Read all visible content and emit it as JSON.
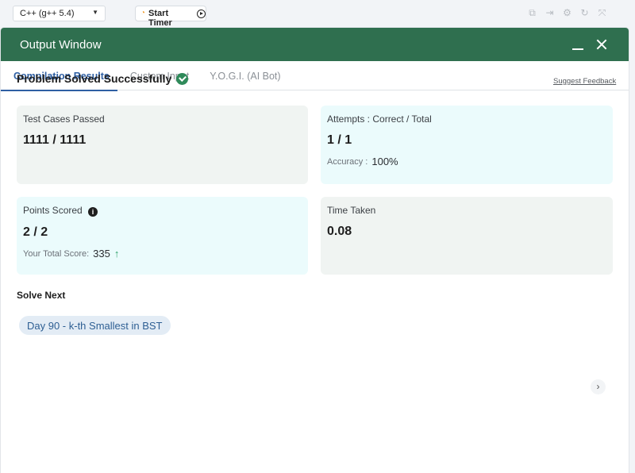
{
  "toolbar": {
    "language": "C++ (g++ 5.4)",
    "timer_label": "Start Timer"
  },
  "window": {
    "title": "Output Window"
  },
  "tabs": [
    {
      "label": "Compilation Results",
      "active": true
    },
    {
      "label": "Custom Input",
      "active": false
    },
    {
      "label": "Y.O.G.I. (AI Bot)",
      "active": false
    }
  ],
  "status": {
    "title": "Problem Solved Successfully",
    "feedback_link": "Suggest Feedback"
  },
  "cards": {
    "test_cases": {
      "label": "Test Cases Passed",
      "value": "1111 / 1111"
    },
    "attempts": {
      "label": "Attempts : Correct / Total",
      "value": "1 / 1",
      "sub_label": "Accuracy :",
      "sub_value": "100%"
    },
    "points": {
      "label": "Points Scored",
      "value": "2 / 2",
      "sub_label": "Your Total Score:",
      "sub_value": "335"
    },
    "time": {
      "label": "Time Taken",
      "value": "0.08"
    }
  },
  "solve_next": {
    "heading": "Solve Next",
    "item": "Day 90 - k-th Smallest in BST"
  },
  "colors": {
    "header_green": "#2f6f4f",
    "active_tab_blue": "#2e5fa3",
    "success_green": "#2f8a5a",
    "card_grey": "#f0f4f2",
    "card_blue": "#ebfbfc"
  }
}
